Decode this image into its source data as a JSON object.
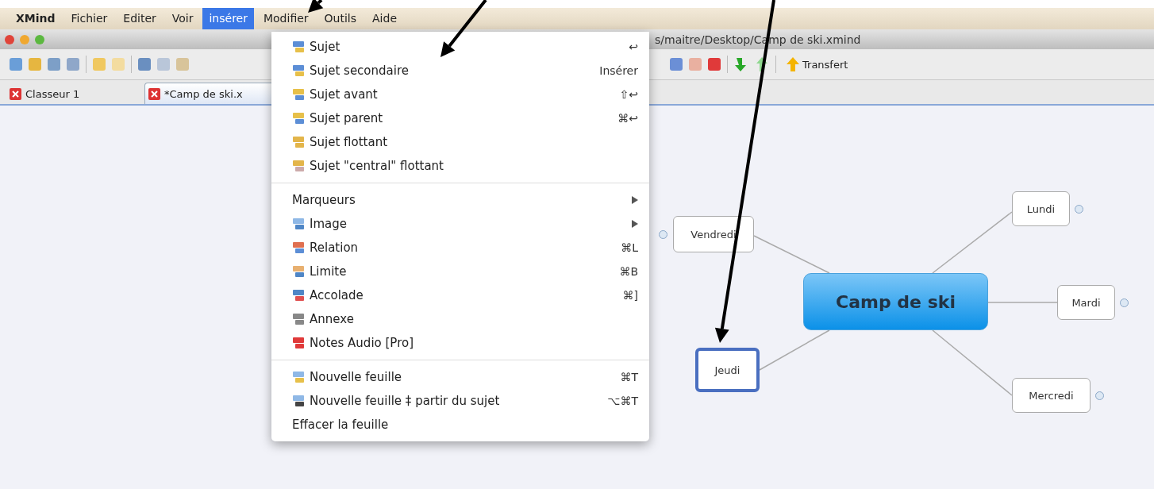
{
  "menu_bar": [
    {
      "label": "XMind",
      "selected": false
    },
    {
      "label": "Fichier",
      "selected": false
    },
    {
      "label": "Editer",
      "selected": false
    },
    {
      "label": "Voir",
      "selected": false
    },
    {
      "label": "insérer",
      "selected": true
    },
    {
      "label": "Modifier",
      "selected": false
    },
    {
      "label": "Outils",
      "selected": false
    },
    {
      "label": "Aide",
      "selected": false
    }
  ],
  "window": {
    "title": "s/maitre/Desktop/Camp de ski.xmind"
  },
  "toolbar": {
    "transfer_button": "Transfert"
  },
  "tabs": [
    {
      "label": "Classeur 1",
      "selected": false
    },
    {
      "label": "*Camp de ski.x",
      "selected": true
    }
  ],
  "menu": {
    "sections": [
      [
        {
          "label": "Sujet",
          "shortcut": "↩",
          "submenu": false
        },
        {
          "label": "Sujet secondaire",
          "shortcut": "Insérer",
          "submenu": false
        },
        {
          "label": "Sujet avant",
          "shortcut": "⇧↩",
          "submenu": false
        },
        {
          "label": "Sujet parent",
          "shortcut": "⌘↩",
          "submenu": false
        },
        {
          "label": "Sujet flottant",
          "submenu": false
        },
        {
          "label": "Sujet \"central\" flottant",
          "submenu": false
        }
      ],
      [
        {
          "label": "Marqueurs",
          "submenu": true
        },
        {
          "label": "Image",
          "submenu": true
        },
        {
          "label": "Relation",
          "shortcut": "⌘L",
          "submenu": false
        },
        {
          "label": "Limite",
          "shortcut": "⌘B",
          "submenu": false
        },
        {
          "label": "Accolade",
          "shortcut": "⌘]",
          "submenu": false
        },
        {
          "label": "Annexe",
          "submenu": false
        },
        {
          "label": "Notes Audio [Pro]",
          "submenu": false
        }
      ],
      [
        {
          "label": "Nouvelle feuille",
          "shortcut": "⌘T",
          "submenu": false
        },
        {
          "label": "Nouvelle feuille ‡ partir du sujet",
          "shortcut": "⌥⌘T",
          "submenu": false
        },
        {
          "label": "Effacer la feuille",
          "submenu": false
        }
      ]
    ]
  },
  "map": {
    "central": "Camp de ski",
    "topics": [
      {
        "label": "Vendredi",
        "selected": false
      },
      {
        "label": "Lundi",
        "selected": false
      },
      {
        "label": "Mardi",
        "selected": false
      },
      {
        "label": "Mercredi",
        "selected": false
      },
      {
        "label": "Jeudi",
        "selected": true
      }
    ]
  }
}
